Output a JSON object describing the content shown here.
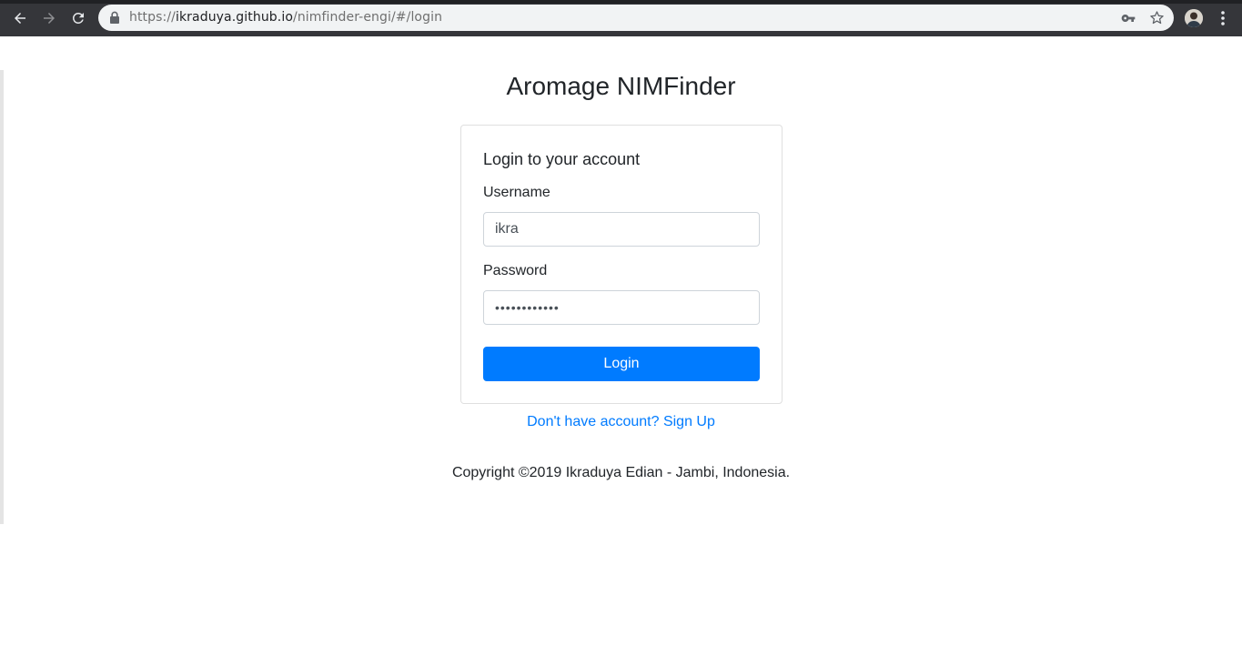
{
  "browser": {
    "url": {
      "scheme": "https://",
      "host": "ikraduya.github.io",
      "path": "/nimfinder-engi/#/login"
    },
    "icons": {
      "back": "arrow-left-icon",
      "forward": "arrow-right-icon",
      "reload": "reload-icon",
      "lock": "lock-icon",
      "key": "key-icon",
      "star": "star-icon",
      "menu": "kebab-menu-icon"
    }
  },
  "page": {
    "title": "Aromage NIMFinder",
    "login_card": {
      "heading": "Login to your account",
      "username_label": "Username",
      "username_value": "ikra",
      "password_label": "Password",
      "password_value": "••••••••••••",
      "login_button": "Login"
    },
    "signup_link": "Don't have account? Sign Up",
    "copyright": "Copyright ©2019 Ikraduya Edian - Jambi, Indonesia."
  },
  "colors": {
    "primary": "#007bff",
    "chrome": "#35363a",
    "omnibox": "#f1f3f4"
  }
}
